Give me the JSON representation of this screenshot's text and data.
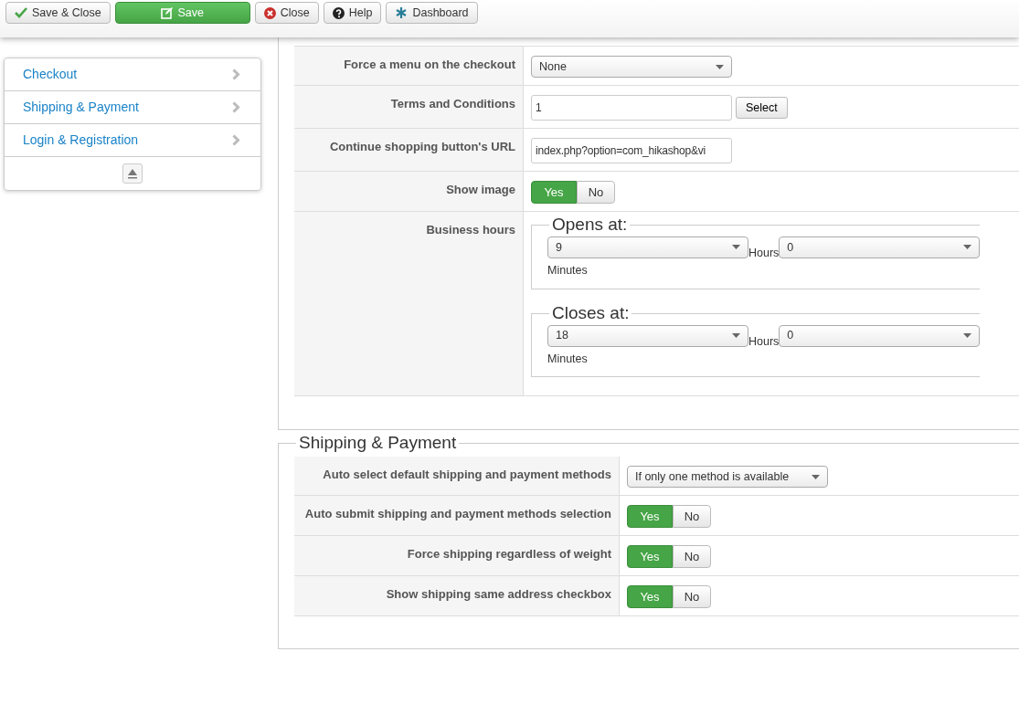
{
  "toolbar": [
    {
      "label": "Save & Close",
      "kind": "check",
      "primary": false
    },
    {
      "label": "Save",
      "kind": "edit",
      "primary": true
    },
    {
      "label": "Close",
      "kind": "close",
      "primary": false
    },
    {
      "label": "Help",
      "kind": "help",
      "primary": false
    },
    {
      "label": "Dashboard",
      "kind": "dashboard",
      "primary": false
    }
  ],
  "sidebar": {
    "items": [
      {
        "label": "Checkout"
      },
      {
        "label": "Shipping & Payment"
      },
      {
        "label": "Login & Registration"
      }
    ]
  },
  "sections": [
    {
      "rows": [
        {
          "label": "Force a menu on the checkout",
          "kind": "select",
          "value": "None"
        },
        {
          "label": "Terms and Conditions",
          "kind": "text_select",
          "value": "1",
          "button": "Select"
        },
        {
          "label": "Continue shopping button's URL",
          "kind": "text",
          "value": "index.php?option=com_hikashop&vi"
        },
        {
          "label": "Show image",
          "kind": "toggle",
          "options": [
            {
              "label": "Yes",
              "selected": true
            },
            {
              "label": "No",
              "selected": false
            }
          ]
        },
        {
          "label": "Business hours",
          "kind": "hours",
          "groups": [
            {
              "legend": "Opens at:",
              "hours": "9",
              "hours_label": "Hours",
              "minutes": "0",
              "minutes_label": "Minutes"
            },
            {
              "legend": "Closes at:",
              "hours": "18",
              "hours_label": "Hours",
              "minutes": "0",
              "minutes_label": "Minutes"
            }
          ]
        }
      ]
    },
    {
      "legend": "Shipping & Payment",
      "rows": [
        {
          "label": "Auto select default shipping and payment methods",
          "kind": "select",
          "value": "If only one method is available"
        },
        {
          "label": "Auto submit shipping and payment methods selection",
          "kind": "toggle",
          "options": [
            {
              "label": "Yes",
              "selected": true
            },
            {
              "label": "No",
              "selected": false
            }
          ]
        },
        {
          "label": "Force shipping regardless of weight",
          "kind": "toggle",
          "options": [
            {
              "label": "Yes",
              "selected": true
            },
            {
              "label": "No",
              "selected": false
            }
          ]
        },
        {
          "label": "Show shipping same address checkbox",
          "kind": "toggle",
          "options": [
            {
              "label": "Yes",
              "selected": true
            },
            {
              "label": "No",
              "selected": false
            }
          ]
        }
      ]
    }
  ]
}
